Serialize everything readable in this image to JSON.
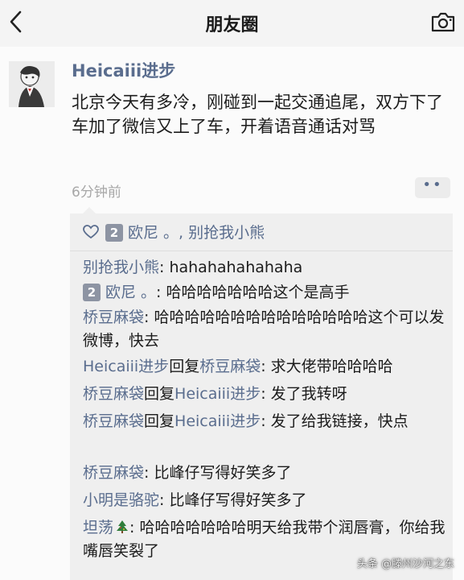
{
  "header": {
    "back_icon": "chevron-left-icon",
    "title": "朋友圈",
    "camera_icon": "camera-icon"
  },
  "post": {
    "author": "Heicaiii进步",
    "content": "北京今天有多冷，刚碰到一起交通追尾，双方下了车加了微信又上了车，开着语音通话对骂",
    "time": "6分钟前",
    "more_label": "••"
  },
  "likes": {
    "heart_icon": "heart-icon",
    "badge": "2",
    "names": "欧尼 。, 别抢我小熊"
  },
  "comments": [
    {
      "badge": "",
      "author": "别抢我小熊",
      "reply_word": "",
      "reply_to": "",
      "text": ": hahahahahahaha",
      "icon": ""
    },
    {
      "badge": "2",
      "author": "欧尼 。",
      "reply_word": "",
      "reply_to": "",
      "text": ": 哈哈哈哈哈哈哈这个是高手",
      "icon": ""
    },
    {
      "badge": "",
      "author": "桥豆麻袋",
      "reply_word": "",
      "reply_to": "",
      "text": ": 哈哈哈哈哈哈哈哈哈哈哈哈哈哈这个可以发微博，快去",
      "icon": ""
    },
    {
      "badge": "",
      "author": "Heicaiii进步",
      "reply_word": "回复",
      "reply_to": "桥豆麻袋",
      "text": ": 求大佬带哈哈哈哈",
      "icon": ""
    },
    {
      "badge": "",
      "author": "桥豆麻袋",
      "reply_word": "回复",
      "reply_to": "Heicaiii进步",
      "text": ": 发了我转呀",
      "icon": ""
    },
    {
      "badge": "",
      "author": "桥豆麻袋",
      "reply_word": "回复",
      "reply_to": "Heicaiii进步",
      "text": ": 发了给我链接，快点",
      "icon": ""
    },
    {
      "badge": "",
      "author": "桥豆麻袋",
      "reply_word": "",
      "reply_to": "",
      "text": ": 比峰仔写得好笑多了",
      "icon": ""
    },
    {
      "badge": "",
      "author": "小明是骆驼",
      "reply_word": "",
      "reply_to": "",
      "text": ": 比峰仔写得好笑多了",
      "icon": ""
    },
    {
      "badge": "",
      "author": "坦荡",
      "reply_word": "",
      "reply_to": "",
      "text": ": 哈哈哈哈哈哈哈明天给我带个润唇膏，你给我嘴唇笑裂了",
      "icon": "christmas-tree-icon"
    }
  ],
  "watermark": "头条 @滕州沙河之东",
  "colors": {
    "link": "#5a6d8e",
    "background": "#fbfbfb",
    "comment_bg": "#efefef",
    "timestamp": "#a7a7a7"
  }
}
